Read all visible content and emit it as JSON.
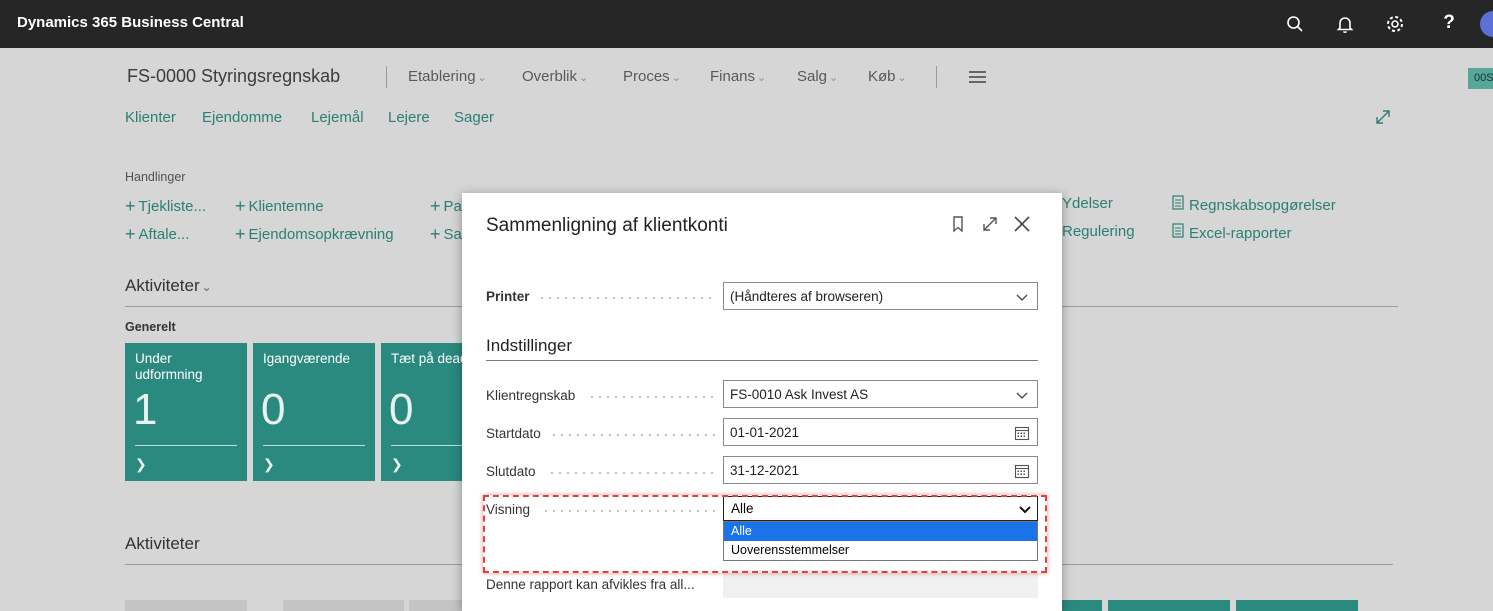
{
  "app": {
    "title": "Dynamics 365 Business Central"
  },
  "topbar_icons": [
    "search-icon",
    "bell-icon",
    "gear-icon",
    "help-icon",
    "avatar"
  ],
  "help_glyph": "?",
  "header": {
    "company": "FS-0000 Styringsregnskab",
    "menus": [
      "Etablering",
      "Overblik",
      "Proces",
      "Finans",
      "Salg",
      "Køb"
    ],
    "right_badge": "00S"
  },
  "nav": [
    "Klienter",
    "Ejendomme",
    "Lejemål",
    "Lejere",
    "Sager"
  ],
  "actions": {
    "label": "Handlinger",
    "items": [
      "Tjekliste...",
      "Aftale...",
      "Klientemne",
      "Ejendomsopkrævning",
      "Pa",
      "Sa",
      "Ydelser",
      "Regulering",
      "Regnskabsopgørelser",
      "Excel-rapporter"
    ]
  },
  "activities": {
    "heading": "Aktiviteter",
    "group": "Generelt",
    "tiles": [
      {
        "name": "Under udformning",
        "value": "1"
      },
      {
        "name": "Igangværende",
        "value": "0"
      },
      {
        "name": "Tæt på dead",
        "value": "0"
      }
    ],
    "heading2": "Aktiviteter"
  },
  "dialog": {
    "title": "Sammenligning af klientkonti",
    "printer_label": "Printer",
    "printer_value": "(Håndteres af browseren)",
    "settings_heading": "Indstillinger",
    "fields": [
      {
        "label": "Klientregnskab",
        "value": "FS-0010 Ask Invest AS"
      },
      {
        "label": "Startdato",
        "value": "01-01-2021"
      },
      {
        "label": "Slutdato",
        "value": "31-12-2021"
      }
    ],
    "visning_label": "Visning",
    "visning_value": "Alle",
    "visning_options": [
      "Alle",
      "Uoverensstemmelser"
    ],
    "note_label": "Denne rapport kan afvikles fra all..."
  },
  "colors": {
    "accent": "#2a7f74",
    "tile": "#2a8a7f",
    "topbar": "#262626",
    "highlight": "#e04040",
    "selected": "#1a73e8"
  }
}
